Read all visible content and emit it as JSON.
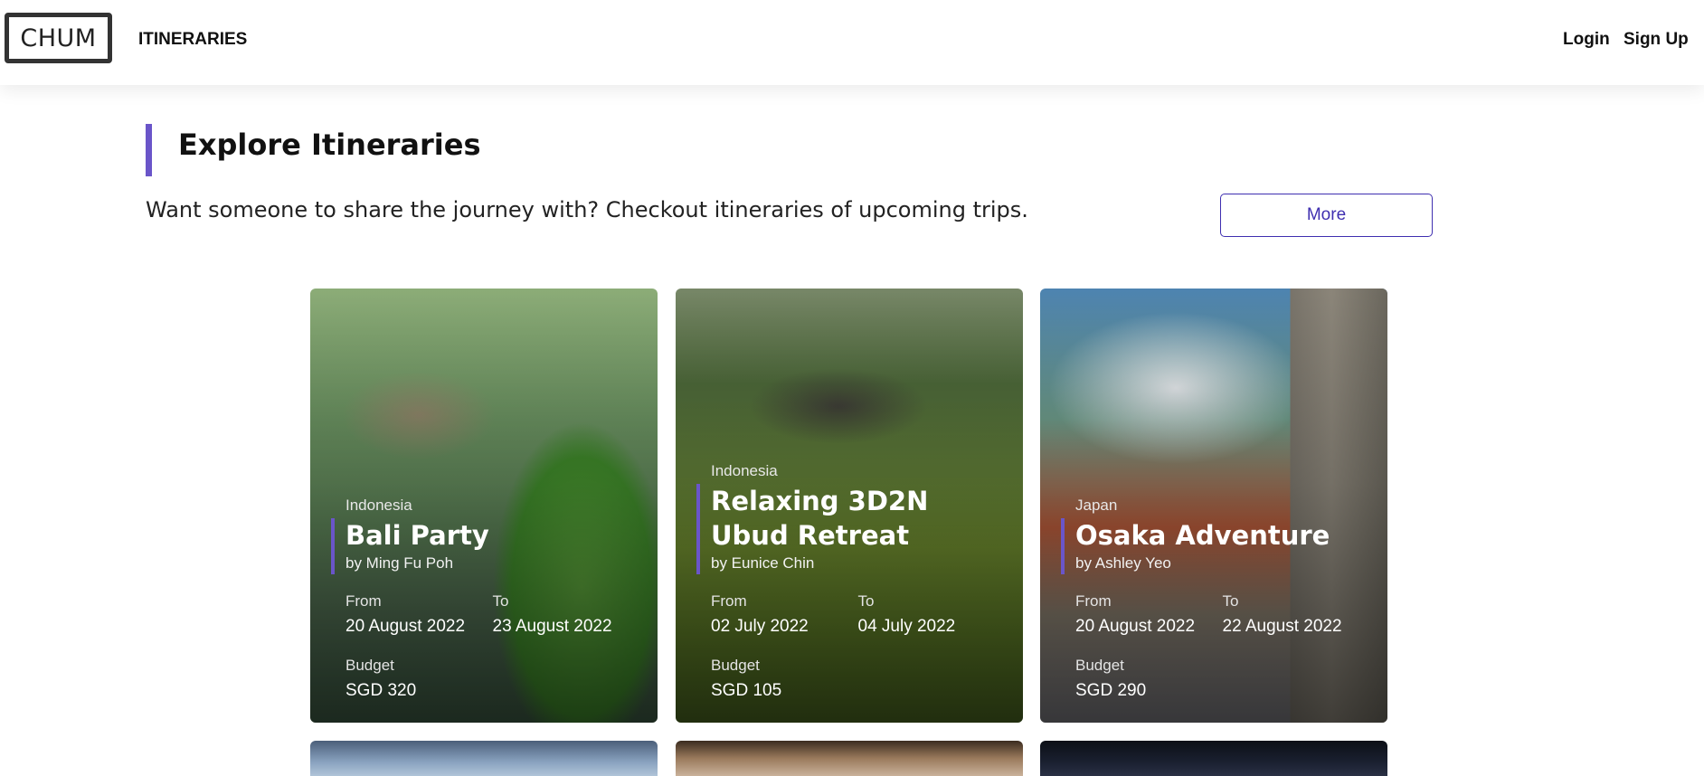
{
  "navbar": {
    "logo": "CHUM",
    "itineraries_link": "ITINERARIES",
    "login_link": "Login",
    "signup_link": "Sign Up"
  },
  "section": {
    "title": "Explore Itineraries",
    "subtitle": "Want someone to share the journey with? Checkout itineraries of upcoming trips.",
    "more_button": "More"
  },
  "colors": {
    "accent": "#6a55c9",
    "more_button": "#3f2fb0"
  },
  "cards": [
    {
      "country": "Indonesia",
      "title": "Bali Party",
      "author": "by Ming Fu Poh",
      "from_label": "From",
      "from": "20 August 2022",
      "to_label": "To",
      "to": "23 August 2022",
      "budget_label": "Budget",
      "budget": "SGD 320"
    },
    {
      "country": "Indonesia",
      "title": "Relaxing 3D2N Ubud Retreat",
      "author": "by Eunice Chin",
      "from_label": "From",
      "from": "02 July 2022",
      "to_label": "To",
      "to": "04 July 2022",
      "budget_label": "Budget",
      "budget": "SGD 105"
    },
    {
      "country": "Japan",
      "title": "Osaka Adventure",
      "author": "by Ashley Yeo",
      "from_label": "From",
      "from": "20 August 2022",
      "to_label": "To",
      "to": "22 August 2022",
      "budget_label": "Budget",
      "budget": "SGD 290"
    }
  ]
}
